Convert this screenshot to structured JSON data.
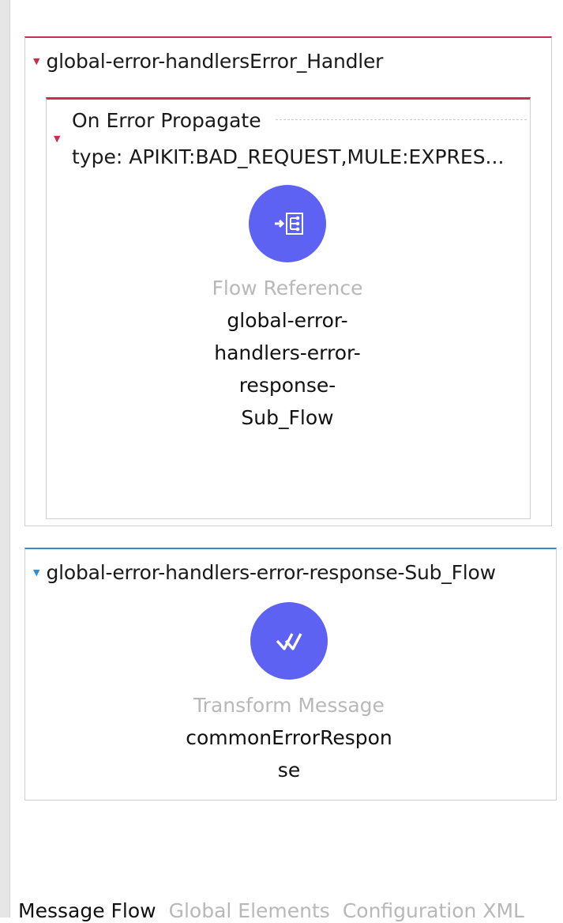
{
  "error_handler": {
    "title": "global-error-handlersError_Handler",
    "on_error": {
      "title": "On Error Propagate",
      "type_text": "type: APIKIT:BAD_REQUEST,MULE:EXPRES..."
    },
    "flow_reference": {
      "type_label": "Flow Reference",
      "name": "global-error-handlers-error-response-Sub_Flow"
    }
  },
  "sub_flow": {
    "title": "global-error-handlers-error-response-Sub_Flow",
    "transform": {
      "type_label": "Transform Message",
      "name": "commonErrorResponse"
    }
  },
  "tabs": [
    {
      "label": "Message Flow",
      "active": true
    },
    {
      "label": "Global Elements",
      "active": false
    },
    {
      "label": "Configuration XML",
      "active": false
    }
  ],
  "icons": {
    "flow_reference": "flow-reference-icon",
    "transform": "dataweave-icon"
  },
  "colors": {
    "error_accent": "#c62f4f",
    "flow_accent": "#2a8de0",
    "component_icon_bg": "#5e62f2"
  }
}
